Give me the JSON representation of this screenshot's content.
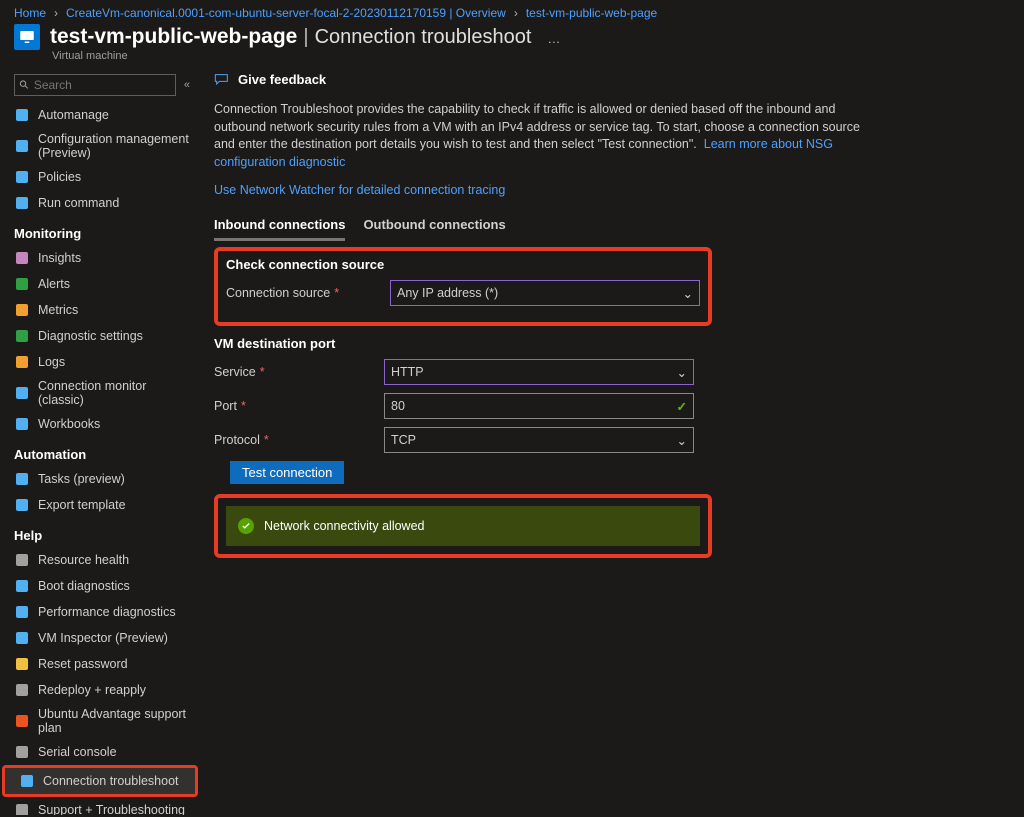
{
  "breadcrumb": {
    "home": "Home",
    "item1": "CreateVm-canonical.0001-com-ubuntu-server-focal-2-20230112170159 | Overview",
    "item2": "test-vm-public-web-page"
  },
  "header": {
    "title": "test-vm-public-web-page",
    "sep": "|",
    "subtitle": "Connection troubleshoot",
    "menu": "…",
    "resource_type": "Virtual machine"
  },
  "search": {
    "placeholder": "Search"
  },
  "nav": {
    "items_top": [
      {
        "icon": "automanage",
        "label": "Automanage"
      },
      {
        "icon": "config",
        "label": "Configuration management (Preview)"
      },
      {
        "icon": "policies",
        "label": "Policies"
      },
      {
        "icon": "run",
        "label": "Run command"
      }
    ],
    "sections": [
      {
        "title": "Monitoring",
        "items": [
          {
            "icon": "insights",
            "label": "Insights"
          },
          {
            "icon": "alerts",
            "label": "Alerts"
          },
          {
            "icon": "metrics",
            "label": "Metrics"
          },
          {
            "icon": "diag",
            "label": "Diagnostic settings"
          },
          {
            "icon": "logs",
            "label": "Logs"
          },
          {
            "icon": "connmon",
            "label": "Connection monitor (classic)"
          },
          {
            "icon": "workbooks",
            "label": "Workbooks"
          }
        ]
      },
      {
        "title": "Automation",
        "items": [
          {
            "icon": "tasks",
            "label": "Tasks (preview)"
          },
          {
            "icon": "export",
            "label": "Export template"
          }
        ]
      },
      {
        "title": "Help",
        "items": [
          {
            "icon": "reshealth",
            "label": "Resource health"
          },
          {
            "icon": "bootdiag",
            "label": "Boot diagnostics"
          },
          {
            "icon": "perfdiag",
            "label": "Performance diagnostics"
          },
          {
            "icon": "vminspect",
            "label": "VM Inspector (Preview)"
          },
          {
            "icon": "resetpw",
            "label": "Reset password"
          },
          {
            "icon": "redeploy",
            "label": "Redeploy + reapply"
          },
          {
            "icon": "ubuntu",
            "label": "Ubuntu Advantage support plan"
          },
          {
            "icon": "serial",
            "label": "Serial console"
          },
          {
            "icon": "conntrouble",
            "label": "Connection troubleshoot",
            "active": true,
            "highlight": true
          },
          {
            "icon": "support",
            "label": "Support + Troubleshooting"
          }
        ]
      }
    ]
  },
  "content": {
    "feedback": "Give feedback",
    "description": "Connection Troubleshoot provides the capability to check if traffic is allowed or denied based off the inbound and outbound network security rules from a VM with an IPv4 address or service tag. To start, choose a connection source and enter the destination port details you wish to test and then select \"Test connection\".",
    "learn_more": "Learn more about NSG configuration diagnostic",
    "network_watcher_link": "Use Network Watcher for detailed connection tracing",
    "tabs": {
      "inbound": "Inbound connections",
      "outbound": "Outbound connections"
    },
    "source_section": {
      "title": "Check connection source",
      "label": "Connection source",
      "value": "Any IP address (*)"
    },
    "dest_section": {
      "title": "VM destination port",
      "service_label": "Service",
      "service_value": "HTTP",
      "port_label": "Port",
      "port_value": "80",
      "protocol_label": "Protocol",
      "protocol_value": "TCP"
    },
    "test_button": "Test connection",
    "result": "Network connectivity allowed"
  }
}
